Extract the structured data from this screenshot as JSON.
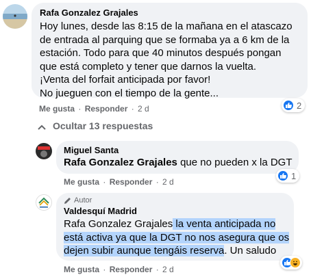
{
  "comment": {
    "author": "Rafa Gonzalez Grajales",
    "lines": [
      "Hoy lunes, desde las 8:15 de la mañana en el atascazo",
      "de entrada al parquing que se formaba ya a 6 km de la",
      "estación. Todo para que 40 minutos después pongan",
      "que está completo y tener que darnos la vuelta.",
      "¡Venta del forfait anticipada por favor!",
      "No jueguen con el tiempo de la gente..."
    ],
    "actions": {
      "like": "Me gusta",
      "reply": "Responder",
      "time": "2 d"
    },
    "reaction_count": "2"
  },
  "replies_toggle": "Ocultar 13 respuestas",
  "reply1": {
    "author": "Miguel Santa",
    "mention": "Rafa Gonzalez Grajales",
    "text": " que no pueden x la DGT",
    "actions": {
      "like": "Me gusta",
      "reply": "Responder",
      "time": "2 d"
    },
    "reaction_count": "1"
  },
  "reply2": {
    "badge": "Autor",
    "author": "Valdesquí Madrid",
    "line1_mention": "Rafa Gonzalez Grajales",
    "line1_rest": " la venta anticipada no",
    "line2": "está activa ya que la DGT no nos asegura que os",
    "line3_hl": "dejen subir aunque tengáis reserva",
    "line3_rest": ". Un saludo",
    "actions": {
      "like": "Me gusta",
      "reply": "Responder",
      "time": "2 d"
    }
  },
  "colors": {
    "like_blue": "#1877f2",
    "selection": "#b3d4fc",
    "bubble": "#f0f2f5"
  }
}
